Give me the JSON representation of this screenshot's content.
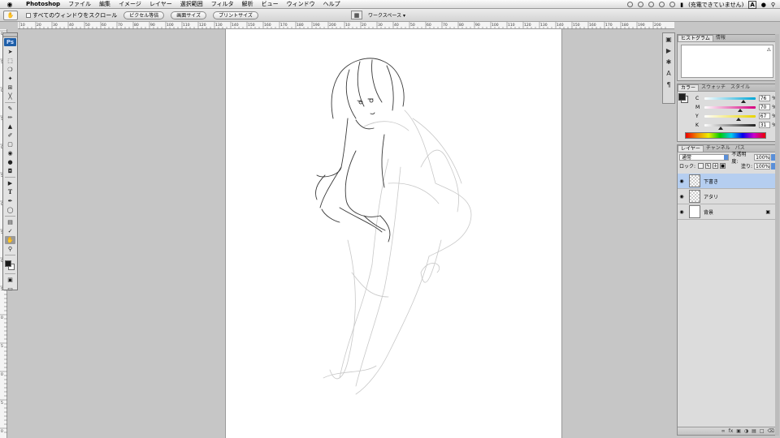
{
  "menubar": {
    "app": "Photoshop",
    "items": [
      "ファイル",
      "編集",
      "イメージ",
      "レイヤー",
      "選択範囲",
      "フィルタ",
      "解析",
      "ビュー",
      "ウィンドウ",
      "ヘルプ"
    ],
    "battery_status": "(充電できていません)",
    "input_badge": "A"
  },
  "options": {
    "scroll_all_label": "すべてのウィンドウをスクロール",
    "actual_pixels": "ピクセル等倍",
    "fit_screen": "画面サイズ",
    "print_size": "プリントサイズ",
    "workspace": "ワークスペース"
  },
  "rulers": {
    "top": [
      "10",
      "20",
      "30",
      "40",
      "50",
      "60",
      "70",
      "80",
      "90",
      "100",
      "110",
      "120",
      "130",
      "140",
      "150",
      "160",
      "170",
      "180",
      "190",
      "200"
    ],
    "left": [
      "0",
      "5",
      "0",
      "5",
      "0",
      "5",
      "0",
      "5",
      "0",
      "5",
      "0",
      "5",
      "0",
      "5"
    ]
  },
  "toolbox": {
    "logo": "Ps"
  },
  "histogram_panel": {
    "tabs": [
      "ヒストグラム",
      "情報"
    ]
  },
  "color_panel": {
    "tabs": [
      "カラー",
      "スウォッチ",
      "スタイル"
    ],
    "channels": [
      {
        "label": "C",
        "value": "76",
        "unit": "%",
        "pos": 0.76,
        "color": "#00a6d6"
      },
      {
        "label": "M",
        "value": "70",
        "unit": "%",
        "pos": 0.7,
        "color": "#d6007e"
      },
      {
        "label": "Y",
        "value": "67",
        "unit": "%",
        "pos": 0.67,
        "color": "#e8d400"
      },
      {
        "label": "K",
        "value": "31",
        "unit": "%",
        "pos": 0.31,
        "color": "#222222"
      }
    ]
  },
  "layers_panel": {
    "tabs": [
      "レイヤー",
      "チャンネル",
      "パス"
    ],
    "blend_mode": "通常",
    "opacity_label": "不透明度:",
    "opacity": "100%",
    "lock_label": "ロック:",
    "fill_label": "塗り:",
    "fill": "100%",
    "layers": [
      {
        "name": "下書き",
        "selected": true,
        "locked": false
      },
      {
        "name": "アタリ",
        "selected": false,
        "locked": false
      },
      {
        "name": "背景",
        "selected": false,
        "locked": true
      }
    ]
  }
}
